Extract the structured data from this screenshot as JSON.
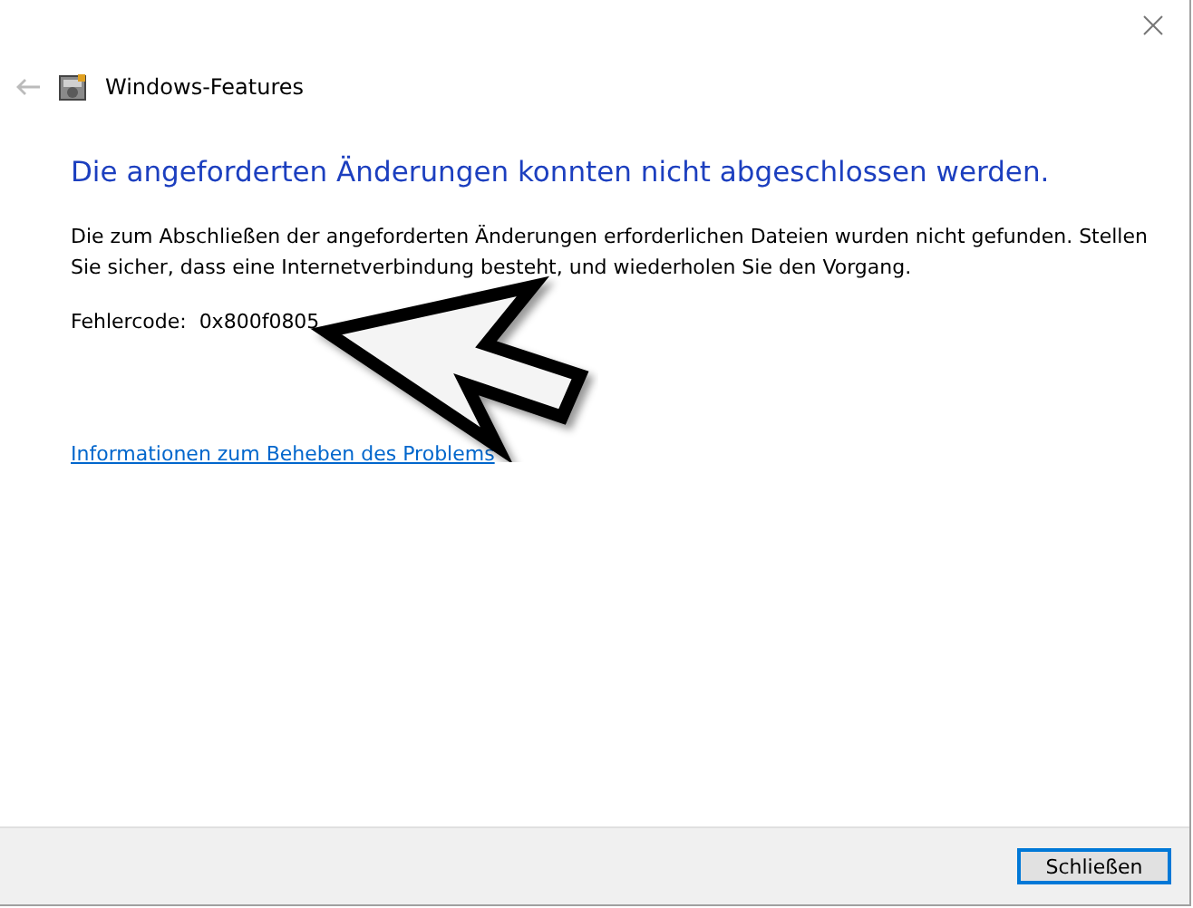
{
  "window": {
    "title": "Windows-Features"
  },
  "heading": "Die angeforderten Änderungen konnten nicht abgeschlossen werden.",
  "message": "Die zum Abschließen der angeforderten Änderungen erforderlichen Dateien wurden nicht gefunden. Stellen Sie sicher, dass eine Internetverbindung besteht, und wiederholen Sie den Vorgang.",
  "error_label": "Fehlercode:",
  "error_code": "0x800f0805",
  "help_link": "Informationen zum Beheben des Problems",
  "buttons": [
    "Schließen"
  ]
}
